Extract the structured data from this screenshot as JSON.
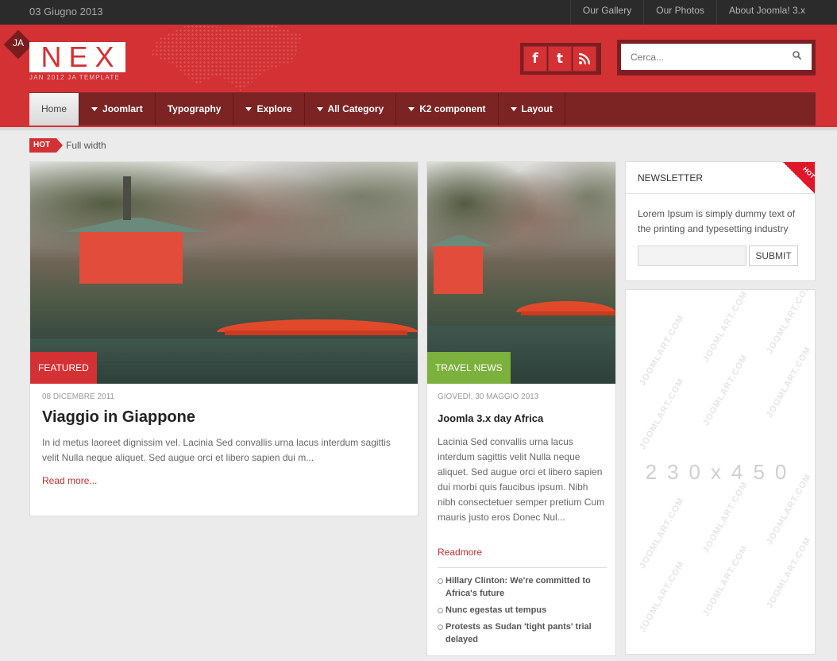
{
  "topbar": {
    "date": "03 Giugno 2013",
    "links": [
      "Our Gallery",
      "Our Photos",
      "About Joomla! 3.x"
    ]
  },
  "logo": {
    "badge": "JA",
    "name": "NEX",
    "subtitle": "JAN 2012 JA TEMPLATE"
  },
  "social": {
    "facebook": "f",
    "twitter": "t",
    "rss": "rss"
  },
  "search": {
    "placeholder": "Cerca..."
  },
  "nav": [
    {
      "label": "Home",
      "active": true,
      "dropdown": false
    },
    {
      "label": "Joomlart",
      "active": false,
      "dropdown": true
    },
    {
      "label": "Typography",
      "active": false,
      "dropdown": false
    },
    {
      "label": "Explore",
      "active": false,
      "dropdown": true
    },
    {
      "label": "All Category",
      "active": false,
      "dropdown": true
    },
    {
      "label": "K2 component",
      "active": false,
      "dropdown": true
    },
    {
      "label": "Layout",
      "active": false,
      "dropdown": true
    }
  ],
  "hotbar": {
    "tag": "HOT",
    "text": "Full width"
  },
  "article1": {
    "category": "FEATURED",
    "date": "08 DICEMBRE 2011",
    "title": "Viaggio in Giappone",
    "excerpt": "In id metus laoreet dignissim vel. Lacinia Sed convallis urna lacus interdum sagittis velit Nulla neque aliquet. Sed augue orci et libero sapien dui m...",
    "readmore": "Read more..."
  },
  "article2": {
    "category": "TRAVEL NEWS",
    "date": "GIOVEDÌ, 30 MAGGIO 2013",
    "title": "Joomla 3.x day Africa",
    "excerpt": "Lacinia Sed convallis urna lacus interdum sagittis velit Nulla neque aliquet. Sed augue orci et libero sapien dui morbi quis faucibus ipsum. Nibh nibh consectetuer semper pretium Cum mauris justo eros Donec Nul...",
    "readmore": "Readmore",
    "related": [
      "Hillary Clinton: We're committed to Africa's future",
      "Nunc egestas ut tempus",
      "Protests as Sudan 'tight pants' trial delayed"
    ]
  },
  "newsletter": {
    "title": "NEWSLETTER",
    "badge": "HOT",
    "description": "Lorem Ipsum is simply dummy text of the printing and typesetting industry",
    "submit": "SUBMIT"
  },
  "ad": {
    "dimensions": "230x450",
    "watermark": "JOOMLART.COM"
  },
  "colors": {
    "brand_red": "#d33134",
    "nav_dark_red": "#7c2324",
    "featured_ribbon": "#d33134",
    "travel_ribbon": "#7bb13c"
  }
}
